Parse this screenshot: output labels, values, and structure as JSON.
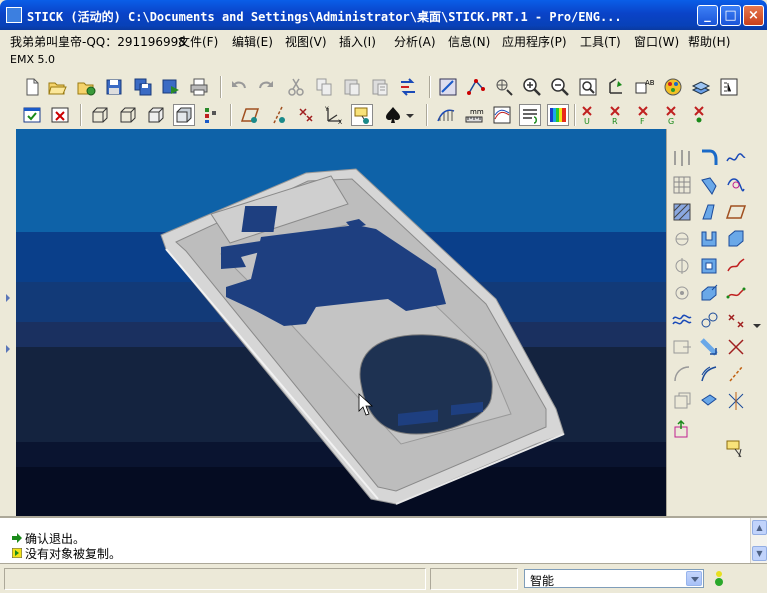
{
  "window": {
    "title": "STICK (活动的) C:\\Documents and Settings\\Administrator\\桌面\\STICK.PRT.1 - Pro/ENG...",
    "minimize_label": "_",
    "maximize_label": "□",
    "close_label": "×"
  },
  "menu": {
    "items": [
      {
        "label": "我弟弟叫皇帝-QQ：291196998"
      },
      {
        "label": "文件(F)"
      },
      {
        "label": "编辑(E)"
      },
      {
        "label": "视图(V)"
      },
      {
        "label": "插入(I)"
      },
      {
        "label": "分析(A)"
      },
      {
        "label": "信息(N)"
      },
      {
        "label": "应用程序(P)"
      },
      {
        "label": "工具(T)"
      },
      {
        "label": "窗口(W)"
      },
      {
        "label": "帮助(H)"
      }
    ]
  },
  "sub_menu": {
    "label": "EMX 5.0"
  },
  "messages": [
    {
      "text": "确认退出。"
    },
    {
      "text": "没有对象被复制。"
    }
  ],
  "status": {
    "filter_value": "智能"
  },
  "colors": {
    "title_bar": "#0a43c8",
    "viewport_bands": [
      "#0e62a8",
      "#0a3f8a",
      "#123a78",
      "#1a3060",
      "#14233f",
      "#0e1a33",
      "#0a1430",
      "#050c22"
    ],
    "model_gray": "#c8c8c8",
    "model_cut": "#1e3f80"
  },
  "icons": {
    "toolbar_row1": [
      "new-icon",
      "open-icon",
      "save-icon",
      "save-copy-icon",
      "backup-icon",
      "print-icon",
      "undo-icon",
      "redo-icon",
      "cut-icon",
      "copy-icon",
      "paste-icon",
      "paste-special-icon",
      "regenerate-icon",
      "datum-plane-icon",
      "datum-axis-icon",
      "spin-center-icon",
      "zoom-in-icon",
      "zoom-out-icon",
      "refit-icon",
      "orient-icon",
      "saved-views-icon",
      "appearance-icon",
      "layers-icon",
      "model-tree-icon"
    ],
    "toolbar_row2": [
      "window-activate-icon",
      "close-window-icon",
      "wireframe-icon",
      "hidden-line-icon",
      "no-hidden-icon",
      "shading-icon",
      "model-tree-settings-icon",
      "plane-display-icon",
      "axis-display-icon",
      "point-display-icon",
      "csys-display-icon",
      "annotation-display-icon",
      "spade-icon",
      "curvature-icon",
      "measure-icon",
      "surface-analysis-icon",
      "draft-check-icon",
      "color-scale-icon",
      "datum-u-icon",
      "datum-r-icon",
      "datum-f-icon",
      "datum-g-icon"
    ],
    "right_toolbar": [
      "mirror-icon",
      "round-icon",
      "curve-icon",
      "pattern-icon",
      "chamfer-icon",
      "datum-curve-icon",
      "hatch-icon",
      "draft-icon",
      "plane-icon",
      "shell-icon",
      "rib-icon",
      "solid-icon",
      "revolve-icon",
      "thicken-icon",
      "sketch-icon",
      "hole-icon",
      "extrude-icon",
      "spline-icon",
      "sweep-icon",
      "blend-icon",
      "point-icon",
      "boundary-icon",
      "merge-icon",
      "intersect-icon",
      "trim-icon",
      "offset-icon",
      "extend-icon",
      "copy-feature-icon",
      "section-icon",
      "fill-icon",
      "assemble-icon",
      "select-filter-icon"
    ]
  }
}
